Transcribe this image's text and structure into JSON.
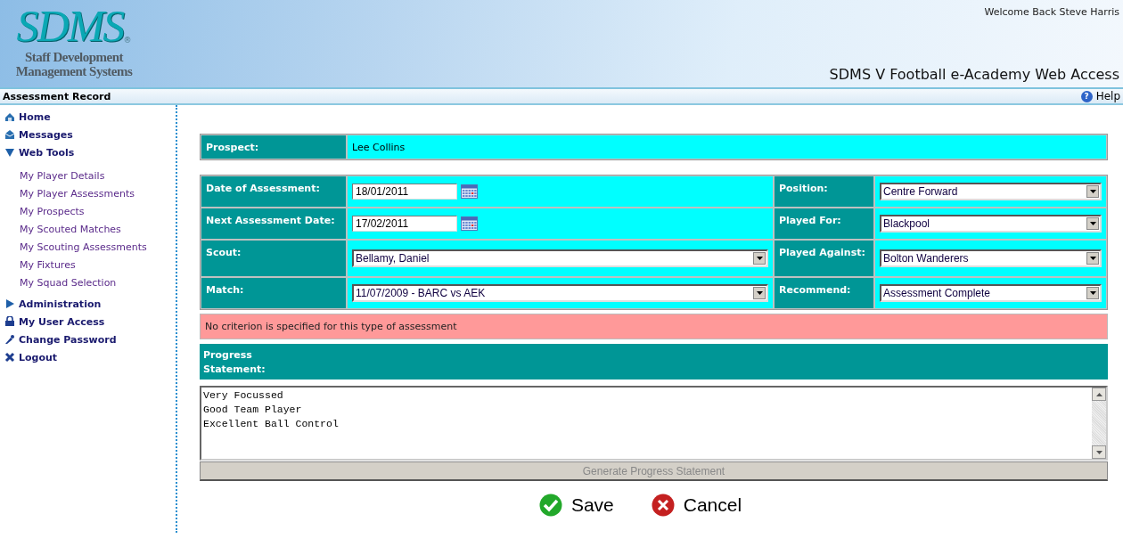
{
  "header": {
    "logo": "SDMS",
    "logo_mark": "®",
    "logo_subtitle": "Staff Development Management Systems",
    "welcome": "Welcome Back Steve Harris",
    "app_title": "SDMS V Football e-Academy Web Access"
  },
  "page_bar": {
    "title": "Assessment Record",
    "help_icon": "?",
    "help": "Help"
  },
  "sidebar": {
    "items": [
      {
        "label": "Home"
      },
      {
        "label": "Messages"
      },
      {
        "label": "Web Tools",
        "expanded": true,
        "children": [
          {
            "label": "My Player Details"
          },
          {
            "label": "My Player Assessments"
          },
          {
            "label": "My Prospects"
          },
          {
            "label": "My Scouted Matches"
          },
          {
            "label": "My Scouting Assessments"
          },
          {
            "label": "My Fixtures"
          },
          {
            "label": "My Squad Selection"
          }
        ]
      },
      {
        "label": "Administration",
        "expanded": false
      },
      {
        "label": "My User Access"
      },
      {
        "label": "Change Password"
      },
      {
        "label": "Logout"
      }
    ]
  },
  "form": {
    "prospect": {
      "label": "Prospect:",
      "value": "Lee Collins"
    },
    "rows": [
      [
        {
          "label": "Date of Assessment:",
          "kind": "date",
          "value": "18/01/2011"
        },
        {
          "label": "Position:",
          "kind": "select",
          "value": "Centre Forward"
        }
      ],
      [
        {
          "label": "Next Assessment Date:",
          "kind": "date",
          "value": "17/02/2011"
        },
        {
          "label": "Played For:",
          "kind": "select",
          "value": "Blackpool"
        }
      ],
      [
        {
          "label": "Scout:",
          "kind": "select",
          "value": "Bellamy, Daniel"
        },
        {
          "label": "Played Against:",
          "kind": "select",
          "value": "Bolton Wanderers"
        }
      ],
      [
        {
          "label": "Match:",
          "kind": "select",
          "value": "11/07/2009 - BARC vs AEK"
        },
        {
          "label": "Recommend:",
          "kind": "select",
          "value": "Assessment Complete"
        }
      ]
    ],
    "alert": "No criterion is specified for this type of assessment",
    "progress_label": "Progress Statement:",
    "progress_text": "Very Focussed\nGood Team Player\nExcellent Ball Control",
    "generate_button": {
      "label": "Generate Progress Statement",
      "disabled": true
    },
    "actions": [
      {
        "kind": "save",
        "label": "Save"
      },
      {
        "kind": "cancel",
        "label": "Cancel"
      }
    ]
  }
}
